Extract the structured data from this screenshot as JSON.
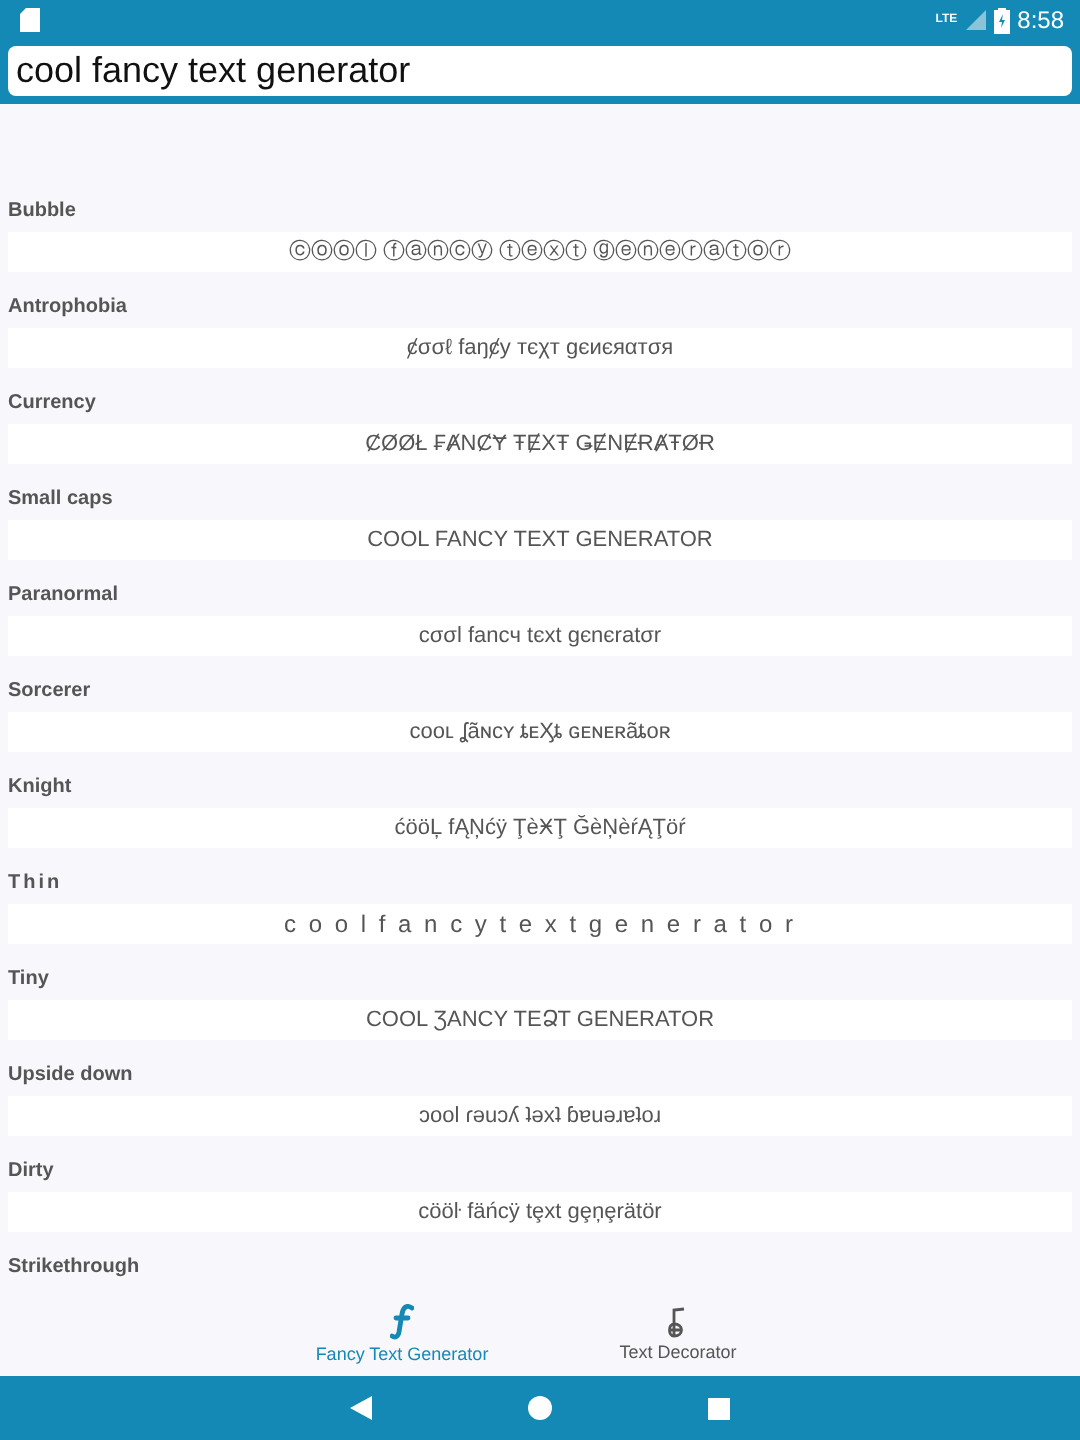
{
  "status_bar": {
    "network": "LTE",
    "time": "8:58"
  },
  "search": {
    "value": "cool fancy text generator"
  },
  "styles": [
    {
      "name": "Bubble",
      "sample": "ⓒⓞⓞⓛ ⓕⓐⓝⓒⓨ ⓣⓔⓧⓣ ⓖⓔⓝⓔⓡⓐⓣⓞⓡ"
    },
    {
      "name": "Antrophobia",
      "sample": "ȼσσℓ faŋȼу тєχт gєиєяαтσя"
    },
    {
      "name": "Currency",
      "sample": "ȻØØŁ ₣ȺNȻɎ ŦɆXŦ ǤɆNɆɌȺŦØɌ"
    },
    {
      "name": "Small caps",
      "sample": "COOL FANCY TEXT GENERATOR"
    },
    {
      "name": "Paranormal",
      "sample": "cσσl fancч tєxt gєnєratσr"
    },
    {
      "name": "Sorcerer",
      "sample": "ᴄᴏᴏʟ ʆãɴᴄʏ ȶᴇӼȶ ɢᴇɴᴇʀãȶᴏʀ"
    },
    {
      "name": "Knight",
      "sample": "ćööĻ fĄŅćÿ ŢèӾŢ ĞèŅèŕĄŢöŕ"
    },
    {
      "name": "Thin",
      "sample": "c o o l  f a n c y  t e x t  g e n e r a t o r"
    },
    {
      "name": "Tiny",
      "sample": "COOL ƷANCY TEՁT GENERATOR"
    },
    {
      "name": "Upside down",
      "sample": "ɔool ɾǝuɔʎ ʇǝxʇ ɓɐuǝɹɐʇoɹ"
    },
    {
      "name": "Dirty",
      "sample": "cööŀ fäńcÿ tȩxt gȩņȩrätör"
    },
    {
      "name": "Strikethrough"
    }
  ],
  "bottom_nav": [
    {
      "label": "Fancy Text Generator",
      "selected": true
    },
    {
      "label": "Text Decorator",
      "selected": false
    }
  ]
}
